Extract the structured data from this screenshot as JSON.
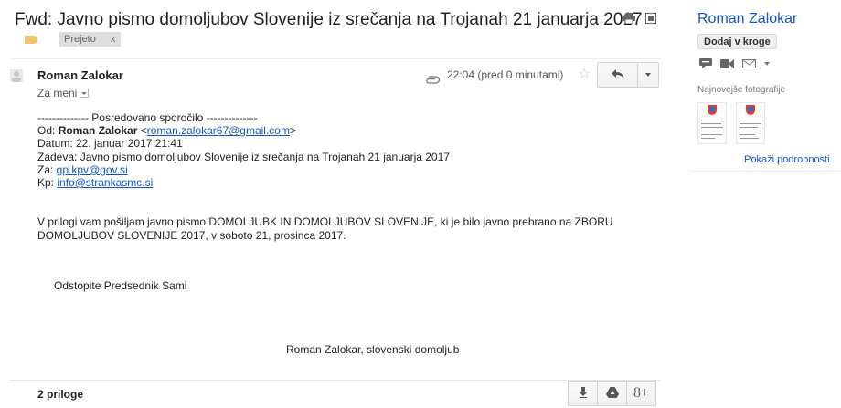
{
  "email": {
    "subject": "Fwd: Javno pismo domoljubov Slovenije iz srečanja na Trojanah 21 januarja 2017",
    "label_chip": "Prejeto",
    "label_remove": "x",
    "sender_name": "Roman Zalokar",
    "to_me": "Za meni",
    "time": "22:04 (pred 0 minutami)",
    "forward": {
      "header": "-------------- Posredovano sporočilo --------------",
      "from_prefix": "Od: ",
      "from_name": "Roman Zalokar",
      "from_open": " <",
      "from_email": "roman.zalokar67@gmail.com",
      "from_close": ">",
      "date": "Datum: 22. januar 2017 21:41",
      "subject_line": "Zadeva: Javno pismo domoljubov Slovenije iz srečanja na Trojanah 21 januarja 2017",
      "to_prefix": "Za: ",
      "to_email": "gp.kpv@gov.si",
      "cc_prefix": "Kp: ",
      "cc_email": "info@strankasmc.si"
    },
    "paragraph": " V prilogi vam pošiljam javno pismo DOMOLJUBK IN DOMOLJUBOV SLOVENIJE, ki je bilo javno prebrano na ZBORU DOMOLJUBOV SLOVENIJE 2017, v soboto 21, prosinca 2017.",
    "closing": "Odstopite  Predsednik Sami",
    "signature": "Roman Zalokar, slovenski domoljub",
    "attachments_count": "2 priloge",
    "gplus_label": "8+"
  },
  "sidebar": {
    "contact_name": "Roman Zalokar",
    "add_to_circles": "Dodaj v kroge",
    "recent_photos": "Najnovejše fotografije",
    "show_details": "Pokaži podrobnosti"
  },
  "colors": {
    "link": "#1155cc",
    "important_marker": "#f1c36a",
    "label_chip": "#dddddd"
  }
}
